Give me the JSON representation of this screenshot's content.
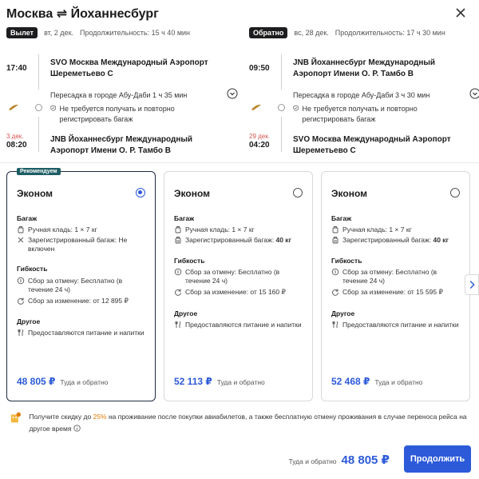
{
  "header": {
    "title": "Москва ⇌ Йоханнесбург",
    "close_icon": "close-icon"
  },
  "outbound": {
    "badge": "Вылет",
    "date": "вт, 2 дек.",
    "duration": "Продолжительность: 15 ч 40 мин",
    "dep_time": "17:40",
    "dep_airport": "SVO Москва Международный Аэропорт Шереметьево С",
    "transfer": "Пересадка в городе Абу-Даби",
    "transfer_duration": "1 ч 35 мин",
    "baggage_note": "Не требуется получать и повторно регистрировать багаж",
    "arr_nextday": "3 дек.",
    "arr_time": "08:20",
    "arr_airport": "JNB Йоханнесбург Международный Аэропорт Имени О. Р. Тамбо В"
  },
  "return": {
    "badge": "Обратно",
    "date": "вс, 28 дек.",
    "duration": "Продолжительность: 17 ч 30 мин",
    "dep_time": "09:50",
    "dep_airport": "JNB Йоханнесбург Международный Аэропорт Имени О. Р. Тамбо В",
    "transfer": "Пересадка в городе Абу-Даби",
    "transfer_duration": "3 ч 30 мин",
    "baggage_note": "Не требуется получать и повторно регистрировать багаж",
    "arr_nextday": "29 дек.",
    "arr_time": "04:20",
    "arr_airport": "SVO Москва Международный Аэропорт Шереметьево С"
  },
  "fares": [
    {
      "badge": "Рекомендуем",
      "title": "Эконом",
      "selected": true,
      "baggage_title": "Багаж",
      "carry_on": "Ручная кладь: 1 × 7 кг",
      "checked": "Зарегистрированный багаж: Не включен",
      "flex_title": "Гибкость",
      "cancel": "Сбор за отмену: Бесплатно (в течение 24 ч)",
      "change": "Сбор за изменение: от 12 895 ₽",
      "other_title": "Другое",
      "meals": "Предоставляются питание и напитки",
      "price": "48 805 ₽",
      "price_label": "Туда и обратно"
    },
    {
      "title": "Эконом",
      "selected": false,
      "baggage_title": "Багаж",
      "carry_on": "Ручная кладь: 1 × 7 кг",
      "checked_prefix": "Зарегистрированный багаж:",
      "checked_value": "40 кг",
      "flex_title": "Гибкость",
      "cancel": "Сбор за отмену: Бесплатно (в течение 24 ч)",
      "change": "Сбор за изменение: от 15 160 ₽",
      "other_title": "Другое",
      "meals": "Предоставляются питание и напитки",
      "price": "52 113 ₽",
      "price_label": "Туда и обратно"
    },
    {
      "title": "Эконом",
      "selected": false,
      "baggage_title": "Багаж",
      "carry_on": "Ручная кладь: 1 × 7 кг",
      "checked_prefix": "Зарегистрированный багаж:",
      "checked_value": "40 кг",
      "flex_title": "Гибкость",
      "cancel": "Сбор за отмену: Бесплатно (в течение 24 ч)",
      "change": "Сбор за изменение: от 15 595 ₽",
      "other_title": "Другое",
      "meals": "Предоставляются питание и напитки",
      "price": "52 468 ₽",
      "price_label": "Туда и обратно"
    }
  ],
  "promo": {
    "before": "Получите скидку до",
    "pct": "25%",
    "after": "на проживание после покупки авиабилетов, а также бесплатную отмену проживания в случае переноса рейса на другое время"
  },
  "footer": {
    "label": "Туда и обратно",
    "price": "48 805 ₽",
    "button": "Продолжить"
  },
  "colors": {
    "accent": "#2c5ad9",
    "badge_dark": "#1d1d1f",
    "recommend": "#1d5e64",
    "promo_pct": "#e07b00",
    "nextday": "#d9534f"
  }
}
